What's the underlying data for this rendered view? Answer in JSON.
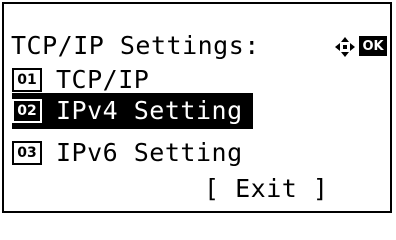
{
  "screen": {
    "title": "TCP/IP Settings:",
    "nav_icon": "four-way-arrow-icon",
    "ok_label": "OK"
  },
  "menu": {
    "items": [
      {
        "number": "01",
        "label": "TCP/IP",
        "selected": false
      },
      {
        "number": "02",
        "label": "IPv4 Setting",
        "selected": true
      },
      {
        "number": "03",
        "label": "IPv6 Setting",
        "selected": false
      }
    ],
    "exit_label": "[ Exit ]"
  },
  "colors": {
    "background": "#ffffff",
    "foreground": "#000000",
    "highlight": "#000000"
  }
}
